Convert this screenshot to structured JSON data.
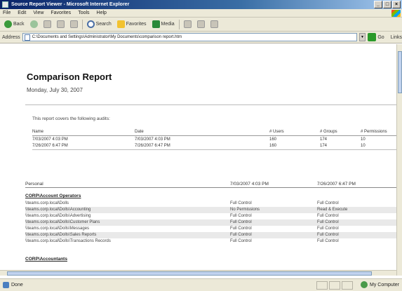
{
  "window": {
    "title": "Source Report Viewer - Microsoft Internet Explorer"
  },
  "menu": [
    "File",
    "Edit",
    "View",
    "Favorites",
    "Tools",
    "Help"
  ],
  "toolbar": {
    "back_label": "Back",
    "search_label": "Search",
    "favorites_label": "Favorites",
    "media_label": "Media"
  },
  "address": {
    "label": "Address",
    "value": "C:\\Documents and Settings\\Administrator\\My Documents\\comparison report.htm",
    "go_label": "Go",
    "links_label": "Links"
  },
  "report": {
    "title": "Comparison Report",
    "date": "Monday, July 30, 2007",
    "intro": "This report covers the following audits:",
    "audit_columns": [
      "Name",
      "Date",
      "# Users",
      "# Groups",
      "# Permissions"
    ],
    "audits": [
      {
        "name": "7/03/2007 4:03 PM",
        "date": "7/03/2007 4:03 PM",
        "users": "160",
        "groups": "174",
        "perms": "10"
      },
      {
        "name": "7/26/2007 6:47 PM",
        "date": "7/26/2007 6:47 PM",
        "users": "160",
        "groups": "174",
        "perms": "10"
      }
    ],
    "perm_columns": [
      "Personal",
      "7/03/2007 4:03 PM",
      "7/26/2007 6:47 PM"
    ],
    "groups": [
      {
        "name": "CORP\\Account Operators",
        "rows": [
          {
            "path": "\\\\teams.corp.local\\Dolls",
            "a": "Full Control",
            "b": "Full Control"
          },
          {
            "path": "\\\\teams.corp.local\\Dolls\\Accounting",
            "a": "No Permissions",
            "b": "Read & Execute"
          },
          {
            "path": "\\\\teams.corp.local\\Dolls\\Advertising",
            "a": "Full Control",
            "b": "Full Control"
          },
          {
            "path": "\\\\teams.corp.local\\Dolls\\Customer Plans",
            "a": "Full Control",
            "b": "Full Control"
          },
          {
            "path": "\\\\teams.corp.local\\Dolls\\Messages",
            "a": "Full Control",
            "b": "Full Control"
          },
          {
            "path": "\\\\teams.corp.local\\Dolls\\Sales Reports",
            "a": "Full Control",
            "b": "Full Control"
          },
          {
            "path": "\\\\teams.corp.local\\Dolls\\Transactions Records",
            "a": "Full Control",
            "b": "Full Control"
          }
        ]
      },
      {
        "name": "CORP\\Accountants",
        "rows": []
      }
    ]
  },
  "status": {
    "text": "Done",
    "zone": "My Computer"
  }
}
